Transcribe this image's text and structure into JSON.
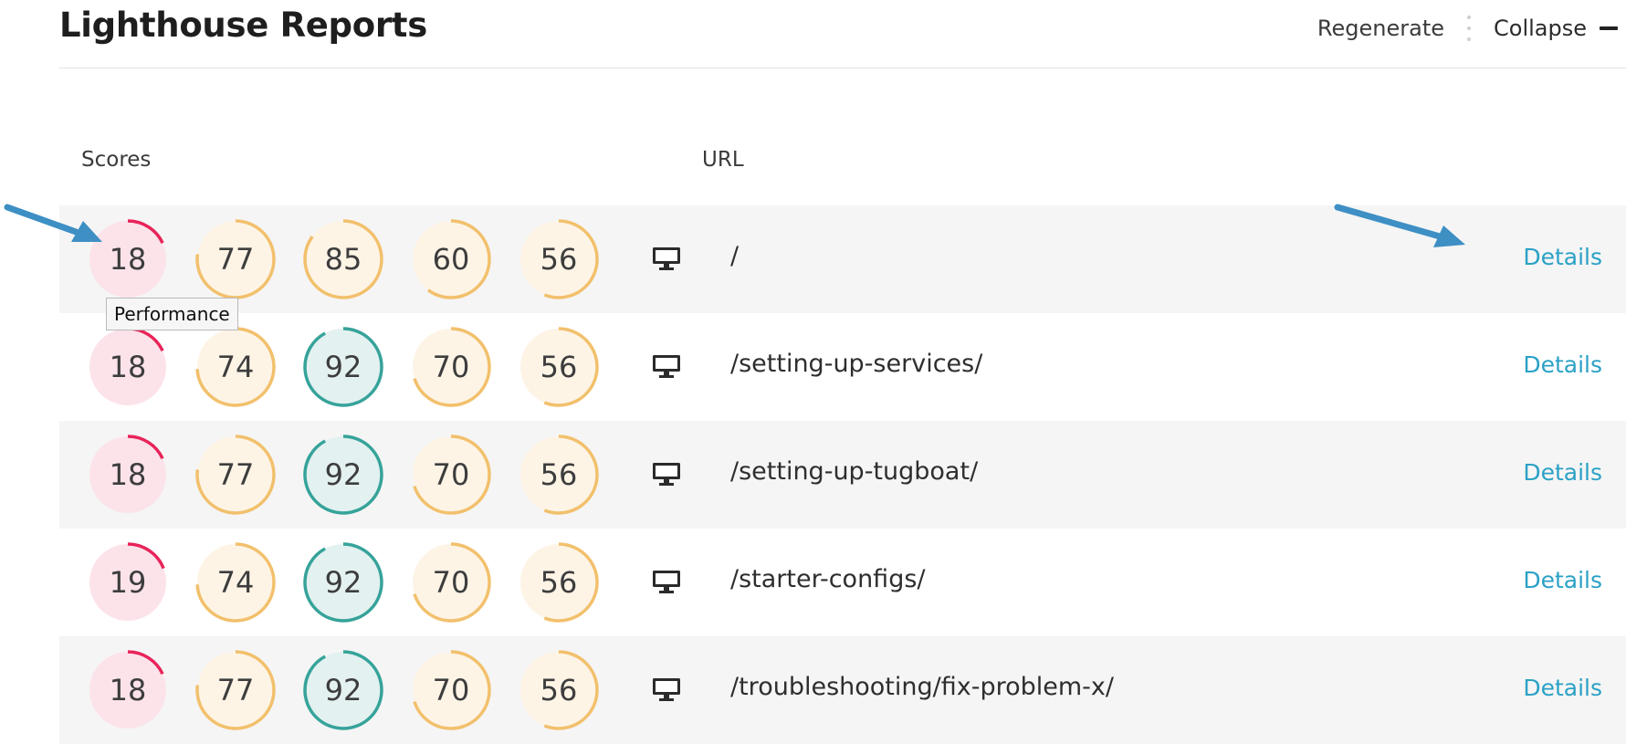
{
  "header": {
    "title": "Lighthouse Reports",
    "regenerate_label": "Regenerate",
    "collapse_label": "Collapse"
  },
  "table": {
    "col_scores": "Scores",
    "col_url": "URL",
    "rows": [
      {
        "scores": [
          18,
          77,
          85,
          60,
          56
        ],
        "device": "desktop-icon",
        "url": "/",
        "details": "Details"
      },
      {
        "scores": [
          18,
          74,
          92,
          70,
          56
        ],
        "device": "desktop-icon",
        "url": "/setting-up-services/",
        "details": "Details"
      },
      {
        "scores": [
          18,
          77,
          92,
          70,
          56
        ],
        "device": "desktop-icon",
        "url": "/setting-up-tugboat/",
        "details": "Details"
      },
      {
        "scores": [
          19,
          74,
          92,
          70,
          56
        ],
        "device": "desktop-icon",
        "url": "/starter-configs/",
        "details": "Details"
      },
      {
        "scores": [
          18,
          77,
          92,
          70,
          56
        ],
        "device": "desktop-icon",
        "url": "/troubleshooting/fix-problem-x/",
        "details": "Details"
      }
    ]
  },
  "tooltip": "Performance",
  "colors": {
    "poor_stroke": "#e8245a",
    "poor_fill": "#fce3ea",
    "avg_stroke": "#f2c06c",
    "avg_fill": "#fdf4e6",
    "good_stroke": "#36a39a",
    "good_fill": "#e3f1f0",
    "link": "#2ba1c6",
    "annotation_arrow": "#3d8fc4"
  }
}
